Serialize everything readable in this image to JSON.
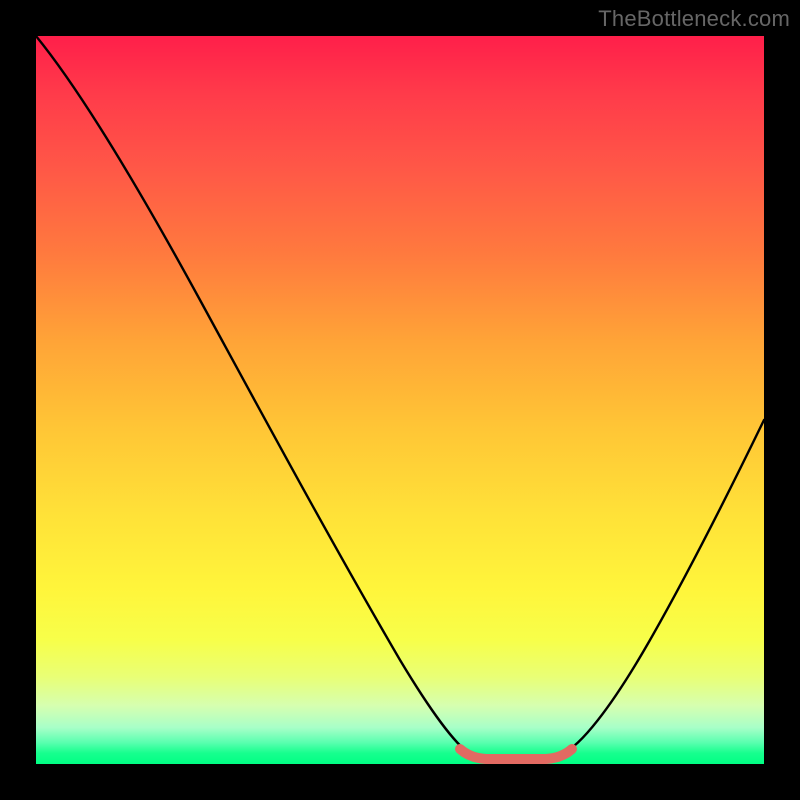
{
  "watermark": {
    "text": "TheBottleneck.com"
  },
  "chart_data": {
    "type": "line",
    "title": "",
    "xlabel": "",
    "ylabel": "",
    "xlim": [
      0,
      100
    ],
    "ylim": [
      0,
      100
    ],
    "background_gradient": {
      "orientation": "vertical",
      "stops": [
        {
          "pos": 0.0,
          "color": "#ff1f4a"
        },
        {
          "pos": 0.3,
          "color": "#ff7a3e"
        },
        {
          "pos": 0.66,
          "color": "#ffe238"
        },
        {
          "pos": 0.88,
          "color": "#e9ff75"
        },
        {
          "pos": 1.0,
          "color": "#00ff84"
        }
      ]
    },
    "series": [
      {
        "name": "bottleneck-curve",
        "stroke": "#000000",
        "points": [
          {
            "x": 0,
            "y": 100
          },
          {
            "x": 10,
            "y": 92
          },
          {
            "x": 20,
            "y": 78
          },
          {
            "x": 30,
            "y": 62
          },
          {
            "x": 40,
            "y": 44
          },
          {
            "x": 50,
            "y": 22
          },
          {
            "x": 56,
            "y": 6
          },
          {
            "x": 60,
            "y": 1
          },
          {
            "x": 66,
            "y": 0
          },
          {
            "x": 72,
            "y": 1
          },
          {
            "x": 78,
            "y": 8
          },
          {
            "x": 86,
            "y": 24
          },
          {
            "x": 94,
            "y": 42
          },
          {
            "x": 100,
            "y": 56
          }
        ]
      },
      {
        "name": "optimal-range-marker",
        "stroke": "#e36a63",
        "points": [
          {
            "x": 58,
            "y": 1.5
          },
          {
            "x": 60,
            "y": 0.6
          },
          {
            "x": 66,
            "y": 0.5
          },
          {
            "x": 72,
            "y": 0.6
          },
          {
            "x": 74,
            "y": 1.5
          }
        ]
      }
    ]
  }
}
